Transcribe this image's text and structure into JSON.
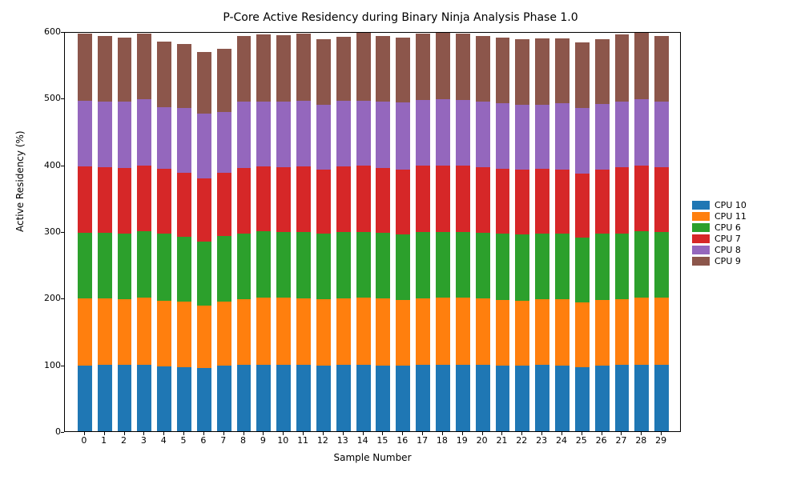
{
  "chart_data": {
    "type": "bar",
    "title": "P-Core Active Residency during Binary Ninja Analysis Phase 1.0",
    "xlabel": "Sample Number",
    "ylabel": "Active Residency (%)",
    "ylim": [
      0,
      600
    ],
    "yticks": [
      0,
      100,
      200,
      300,
      400,
      500,
      600
    ],
    "categories": [
      0,
      1,
      2,
      3,
      4,
      5,
      6,
      7,
      8,
      9,
      10,
      11,
      12,
      13,
      14,
      15,
      16,
      17,
      18,
      19,
      20,
      21,
      22,
      23,
      24,
      25,
      26,
      27,
      28,
      29
    ],
    "series": [
      {
        "name": "CPU 10",
        "color": "#1f77b4",
        "values": [
          99,
          100,
          100,
          100,
          97,
          96,
          95,
          98,
          100,
          100,
          100,
          100,
          99,
          100,
          100,
          99,
          98,
          100,
          100,
          100,
          100,
          98,
          98,
          100,
          99,
          96,
          99,
          100,
          100,
          100
        ]
      },
      {
        "name": "CPU 11",
        "color": "#ff7f0e",
        "values": [
          100,
          99,
          98,
          100,
          99,
          98,
          94,
          97,
          98,
          100,
          100,
          99,
          99,
          99,
          100,
          100,
          99,
          99,
          100,
          100,
          99,
          99,
          98,
          98,
          99,
          97,
          98,
          98,
          100,
          100
        ]
      },
      {
        "name": "CPU 6",
        "color": "#2ca02c",
        "values": [
          99,
          99,
          98,
          100,
          100,
          98,
          95,
          98,
          99,
          100,
          99,
          100,
          98,
          100,
          99,
          99,
          98,
          100,
          99,
          99,
          99,
          99,
          99,
          98,
          98,
          97,
          99,
          99,
          100,
          99
        ]
      },
      {
        "name": "CPU 7",
        "color": "#d62728",
        "values": [
          99,
          98,
          99,
          98,
          98,
          96,
          95,
          95,
          98,
          97,
          97,
          98,
          97,
          98,
          100,
          97,
          98,
          100,
          99,
          99,
          98,
          98,
          97,
          98,
          97,
          97,
          96,
          99,
          99,
          97
        ]
      },
      {
        "name": "CPU 8",
        "color": "#9467bd",
        "values": [
          99,
          98,
          99,
          100,
          92,
          97,
          97,
          91,
          99,
          98,
          99,
          99,
          97,
          99,
          97,
          100,
          100,
          98,
          100,
          99,
          99,
          98,
          98,
          96,
          99,
          98,
          99,
          99,
          99,
          99
        ]
      },
      {
        "name": "CPU 9",
        "color": "#8c564b",
        "values": [
          100,
          99,
          97,
          99,
          99,
          96,
          93,
          95,
          99,
          100,
          99,
          100,
          98,
          96,
          102,
          98,
          97,
          99,
          100,
          100,
          98,
          99,
          98,
          99,
          97,
          98,
          97,
          100,
          100,
          98
        ]
      }
    ]
  },
  "legend": {
    "items": [
      {
        "label": "CPU 10",
        "color": "#1f77b4"
      },
      {
        "label": "CPU 11",
        "color": "#ff7f0e"
      },
      {
        "label": "CPU 6",
        "color": "#2ca02c"
      },
      {
        "label": "CPU 7",
        "color": "#d62728"
      },
      {
        "label": "CPU 8",
        "color": "#9467bd"
      },
      {
        "label": "CPU 9",
        "color": "#8c564b"
      }
    ]
  }
}
